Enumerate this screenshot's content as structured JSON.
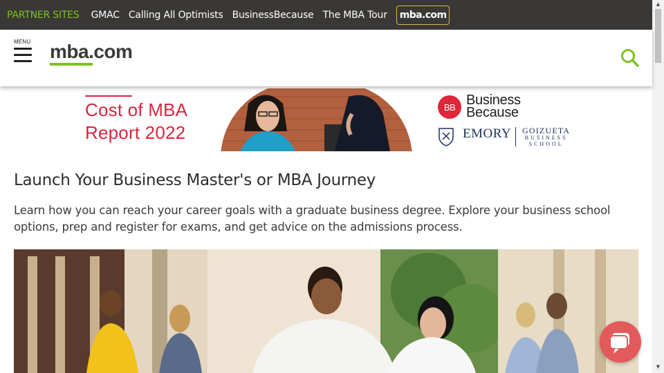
{
  "partner_bar": {
    "label": "PARTNER SITES",
    "links": [
      "GMAC",
      "Calling All Optimists",
      "BusinessBecause",
      "The MBA Tour"
    ],
    "active_link": "mba.com"
  },
  "header": {
    "menu_label": "MENU",
    "logo_text": "mba.com",
    "icons": {
      "menu": "hamburger-menu-icon",
      "search": "search-icon"
    }
  },
  "ad": {
    "title": "Cost of MBA\nReport 2022",
    "bb_mark": "BB",
    "bb_name": "Business\nBecause",
    "emory": "EMORY",
    "goizueta_line1": "GOIZUETA",
    "goizueta_line2": "BUSINESS",
    "goizueta_line3": "SCHOOL"
  },
  "main": {
    "title": "Launch Your Business Master's or MBA Journey",
    "intro": "Learn how you can reach your career goals with a graduate business degree. Explore your business school options, prep and register for exams, and get advice on the admissions process."
  },
  "chat": {
    "icon": "chat-bubble-icon"
  },
  "colors": {
    "partner_bar_bg": "#3a3836",
    "brand_green": "#7dc31e",
    "ad_red": "#d8263d",
    "emory_navy": "#1c2f5a",
    "chat_button": "#e25a5a"
  }
}
